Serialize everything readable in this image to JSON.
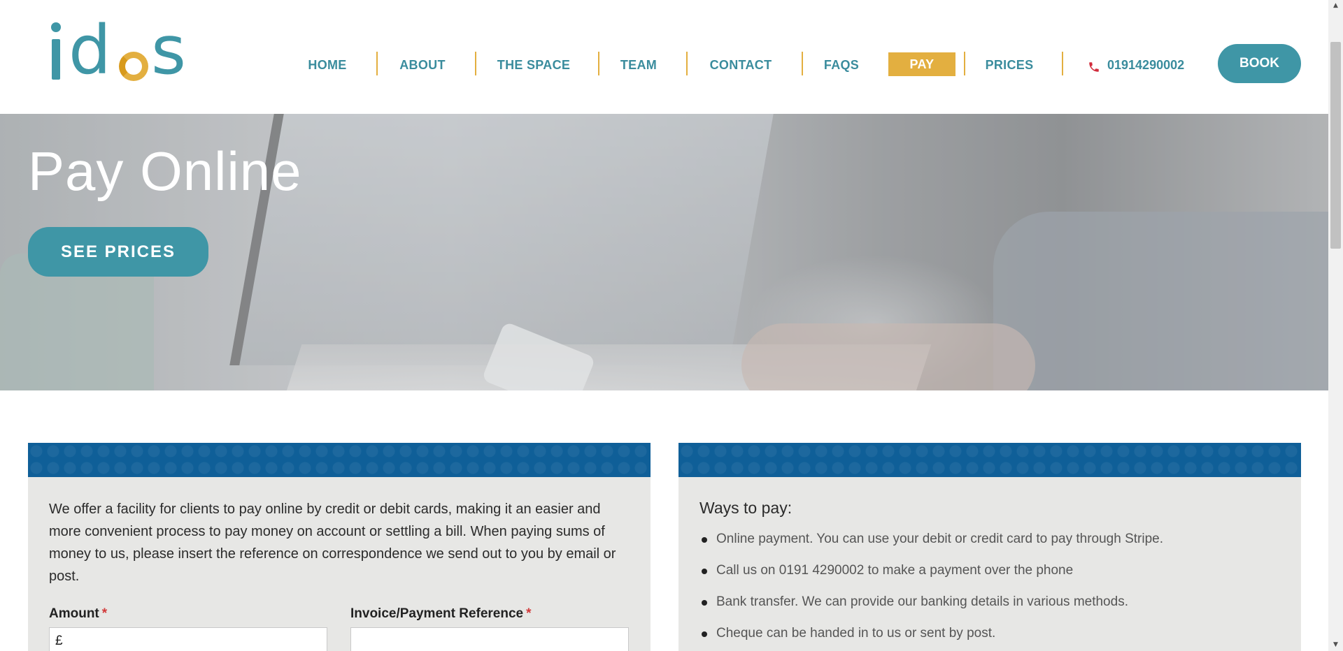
{
  "header": {
    "logo_text": "idos",
    "nav": [
      {
        "label": "HOME"
      },
      {
        "label": "ABOUT"
      },
      {
        "label": "THE SPACE"
      },
      {
        "label": "TEAM"
      },
      {
        "label": "CONTACT"
      },
      {
        "label": "FAQS"
      },
      {
        "label": "PAY"
      },
      {
        "label": "PRICES"
      }
    ],
    "phone": "01914290002",
    "book_label": "BOOK"
  },
  "hero": {
    "title": "Pay Online",
    "button_label": "SEE PRICES"
  },
  "payment_panel": {
    "intro": "We offer a facility for clients to pay online by credit or debit cards, making it an easier and more convenient process to pay money on account or settling a bill. When paying sums of money to us, please insert the reference on correspondence we send out to you by email or post.",
    "amount_label": "Amount",
    "amount_value": "£",
    "reference_label": "Invoice/Payment Reference",
    "required_marker": "*"
  },
  "ways_panel": {
    "title": "Ways to pay:",
    "items": [
      "Online payment. You can use your debit or credit card to pay through Stripe.",
      "Call us on 0191 4290002 to make a payment over the phone",
      "Bank transfer. We can provide our banking details in various methods.",
      "Cheque can be handed in to us or sent by post."
    ]
  },
  "colors": {
    "teal": "#3f96a6",
    "gold": "#e3af40",
    "band_blue": "#0f5f98",
    "panel_bg": "#e7e7e5"
  }
}
